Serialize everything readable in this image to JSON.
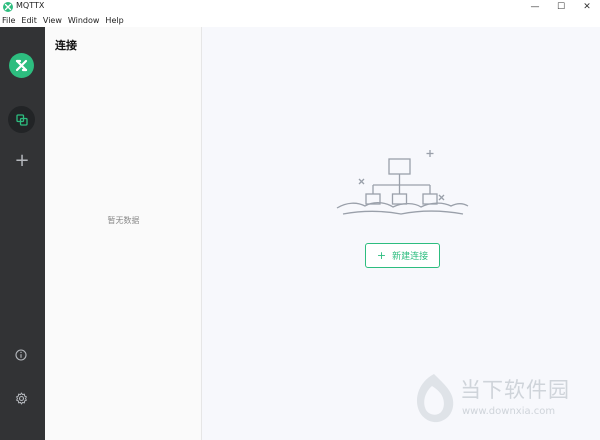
{
  "window": {
    "title": "MQTTX",
    "min_glyph": "—",
    "max_glyph": "☐",
    "close_glyph": "✕"
  },
  "menu": {
    "items": [
      "File",
      "Edit",
      "View",
      "Window",
      "Help"
    ]
  },
  "sidebar": {
    "icons": [
      "logo-icon",
      "connections-icon",
      "add-icon",
      "info-icon",
      "settings-icon"
    ],
    "add_glyph": "+"
  },
  "list_panel": {
    "title": "连接",
    "empty_text": "暂无数据"
  },
  "main": {
    "new_connection_label": "新建连接",
    "plus_glyph": "+"
  },
  "watermark": {
    "chinese": "当下软件园",
    "url": "www.downxia.com"
  },
  "colors": {
    "accent": "#2dbd7f",
    "sidebar_bg": "#323335",
    "main_bg": "#f7f8fc"
  }
}
